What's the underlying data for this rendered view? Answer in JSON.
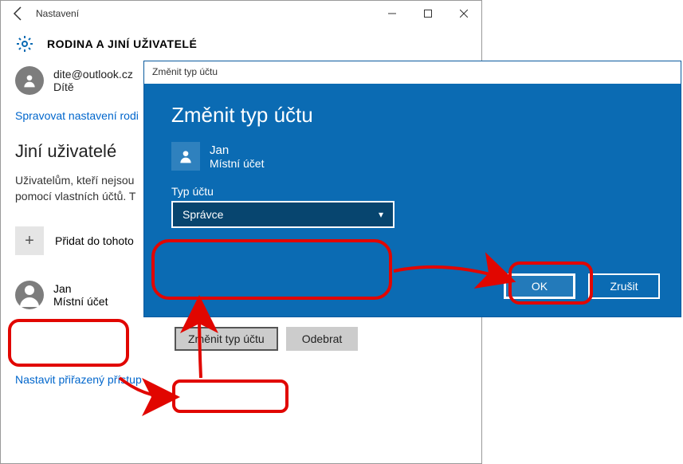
{
  "settings": {
    "windowTitle": "Nastavení",
    "heading": "RODINA A JINÍ UŽIVATELÉ",
    "familyUser": {
      "email": "dite@outlook.cz",
      "role": "Dítě"
    },
    "manageLink": "Spravovat nastavení rodi",
    "otherUsersTitle": "Jiní uživatelé",
    "otherUsersDesc1": "Uživatelům, kteří nejsou",
    "otherUsersDesc2": "pomocí vlastních účtů. T",
    "addLabel": "Přidat do tohoto",
    "jan": {
      "name": "Jan",
      "sub": "Místní účet"
    },
    "changeBtn": "Změnit typ účtu",
    "removeBtn": "Odebrat",
    "assignedLink": "Nastavit přiřazený přístup"
  },
  "dialog": {
    "title": "Změnit typ účtu",
    "heading": "Změnit typ účtu",
    "user": {
      "name": "Jan",
      "sub": "Místní účet"
    },
    "fieldLabel": "Typ účtu",
    "selected": "Správce",
    "ok": "OK",
    "cancel": "Zrušit"
  }
}
